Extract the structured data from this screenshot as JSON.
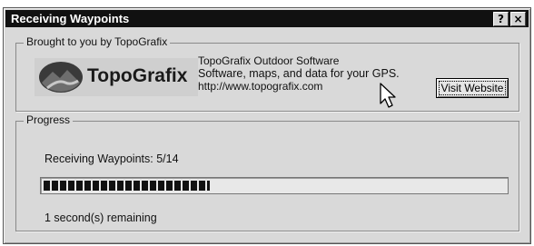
{
  "window": {
    "title": "Receiving Waypoints",
    "help_glyph": "?",
    "close_glyph": "×"
  },
  "sponsor": {
    "legend": "Brought to you by TopoGrafix",
    "logo_text": "TopoGrafix",
    "company": "TopoGrafix Outdoor Software",
    "tagline": "Software, maps, and data for your GPS.",
    "url": "http://www.topografix.com",
    "visit_button": "Visit Website"
  },
  "progress": {
    "legend": "Progress",
    "status": "Receiving Waypoints: 5/14",
    "received": 5,
    "total": 14,
    "fraction": 0.36,
    "remaining": "1 second(s) remaining"
  },
  "colors": {
    "titlebar": "#111111",
    "dialog_bg": "#d9d9d9",
    "progress_fill": "#111111"
  },
  "icons": {
    "logo": "mountain-logo-icon",
    "cursor": "mouse-pointer-icon"
  }
}
